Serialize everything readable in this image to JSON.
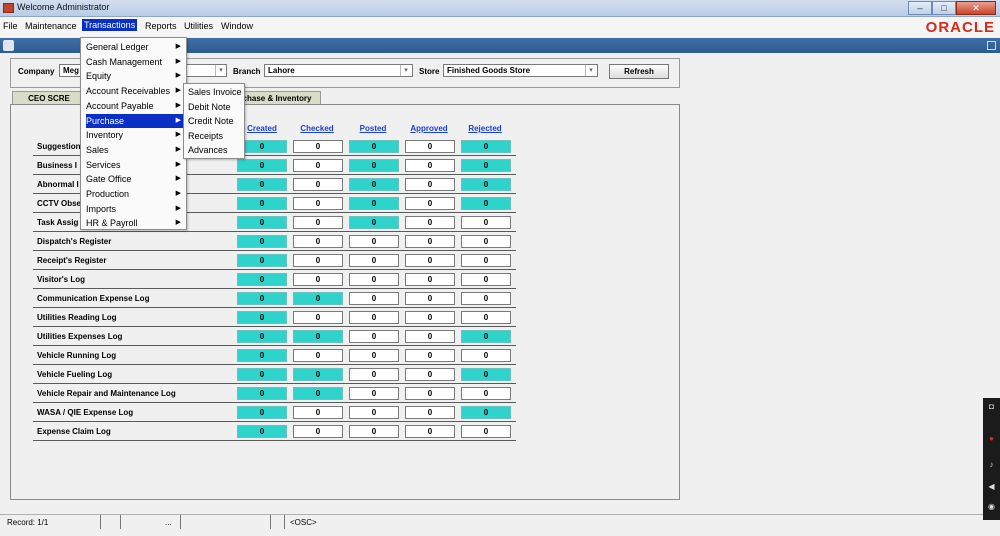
{
  "window": {
    "title": "Welcome Administrator",
    "controls": [
      "–",
      "□",
      "✕"
    ]
  },
  "menubar": {
    "items": [
      "File",
      "Maintenance",
      "Transactions",
      "Reports",
      "Utilities",
      "Window"
    ],
    "active": "Transactions",
    "logo": "ORACLE"
  },
  "filters": {
    "company_label": "Company",
    "company_value": "Meg",
    "branch_label": "Branch",
    "branch_value": "Lahore",
    "store_label": "Store",
    "store_value": "Finished Goods Store",
    "refresh_label": "Refresh"
  },
  "tabs": [
    {
      "label": "CEO SCRE",
      "active": true
    },
    {
      "label": "chase & Inventory",
      "active": false
    }
  ],
  "columns": [
    "Created",
    "Checked",
    "Posted",
    "Approved",
    "Rejected"
  ],
  "rows": [
    {
      "label": "Suggestion",
      "values": [
        "0",
        "0",
        "0",
        "0",
        "0"
      ],
      "teal": [
        true,
        false,
        true,
        false,
        true
      ]
    },
    {
      "label": "Business I",
      "values": [
        "0",
        "0",
        "0",
        "0",
        "0"
      ],
      "teal": [
        true,
        false,
        true,
        false,
        true
      ]
    },
    {
      "label": "Abnormal I",
      "values": [
        "0",
        "0",
        "0",
        "0",
        "0"
      ],
      "teal": [
        true,
        false,
        true,
        false,
        true
      ]
    },
    {
      "label": "CCTV Obse",
      "values": [
        "0",
        "0",
        "0",
        "0",
        "0"
      ],
      "teal": [
        true,
        false,
        true,
        false,
        true
      ]
    },
    {
      "label": "Task Assig",
      "values": [
        "0",
        "0",
        "0",
        "0",
        "0"
      ],
      "teal": [
        true,
        false,
        true,
        false,
        false
      ]
    },
    {
      "label": "Dispatch's Register",
      "values": [
        "0",
        "0",
        "0",
        "0",
        "0"
      ],
      "teal": [
        true,
        false,
        false,
        false,
        false
      ]
    },
    {
      "label": "Receipt's Register",
      "values": [
        "0",
        "0",
        "0",
        "0",
        "0"
      ],
      "teal": [
        true,
        false,
        false,
        false,
        false
      ]
    },
    {
      "label": "Visitor's Log",
      "values": [
        "0",
        "0",
        "0",
        "0",
        "0"
      ],
      "teal": [
        true,
        false,
        false,
        false,
        false
      ]
    },
    {
      "label": "Communication Expense Log",
      "values": [
        "0",
        "0",
        "0",
        "0",
        "0"
      ],
      "teal": [
        true,
        true,
        false,
        false,
        false
      ]
    },
    {
      "label": "Utilities Reading Log",
      "values": [
        "0",
        "0",
        "0",
        "0",
        "0"
      ],
      "teal": [
        true,
        false,
        false,
        false,
        false
      ]
    },
    {
      "label": "Utilities Expenses Log",
      "values": [
        "0",
        "0",
        "0",
        "0",
        "0"
      ],
      "teal": [
        true,
        true,
        false,
        false,
        true
      ]
    },
    {
      "label": "Vehicle Running Log",
      "values": [
        "0",
        "0",
        "0",
        "0",
        "0"
      ],
      "teal": [
        true,
        false,
        false,
        false,
        false
      ]
    },
    {
      "label": "Vehicle Fueling Log",
      "values": [
        "0",
        "0",
        "0",
        "0",
        "0"
      ],
      "teal": [
        true,
        true,
        false,
        false,
        true
      ]
    },
    {
      "label": "Vehicle Repair and Maintenance Log",
      "values": [
        "0",
        "0",
        "0",
        "0",
        "0"
      ],
      "teal": [
        true,
        true,
        false,
        false,
        false
      ]
    },
    {
      "label": "WASA / QIE Expense Log",
      "values": [
        "0",
        "0",
        "0",
        "0",
        "0"
      ],
      "teal": [
        true,
        false,
        false,
        false,
        true
      ]
    },
    {
      "label": "Expense Claim Log",
      "values": [
        "0",
        "0",
        "0",
        "0",
        "0"
      ],
      "teal": [
        true,
        false,
        false,
        false,
        false
      ]
    }
  ],
  "transactions_menu": [
    {
      "label": "General Ledger",
      "arrow": true
    },
    {
      "label": "Cash Management",
      "arrow": true
    },
    {
      "label": "Equity",
      "arrow": true
    },
    {
      "label": "Account Receivables",
      "arrow": true
    },
    {
      "label": "Account Payable",
      "arrow": true
    },
    {
      "label": "Purchase",
      "arrow": true,
      "highlighted": true
    },
    {
      "label": "Inventory",
      "arrow": true
    },
    {
      "label": "Sales",
      "arrow": true
    },
    {
      "label": "Services",
      "arrow": true
    },
    {
      "label": "Gate Office",
      "arrow": true
    },
    {
      "label": "Production",
      "arrow": true
    },
    {
      "label": "Imports",
      "arrow": true
    },
    {
      "label": "HR & Payroll",
      "arrow": true
    }
  ],
  "purchase_submenu": [
    "Sales Invoice",
    "Debit Note",
    "Credit Note",
    "Receipts",
    "Advances"
  ],
  "statusbar": {
    "record": "Record: 1/1",
    "ellipsis": "...",
    "osc": "<OSC>"
  },
  "colors": {
    "accent": "#0a2fc4",
    "teal_cell": "#2ed3cc",
    "column_link": "#1a3fd4",
    "oracle_red": "#d62a1a"
  }
}
